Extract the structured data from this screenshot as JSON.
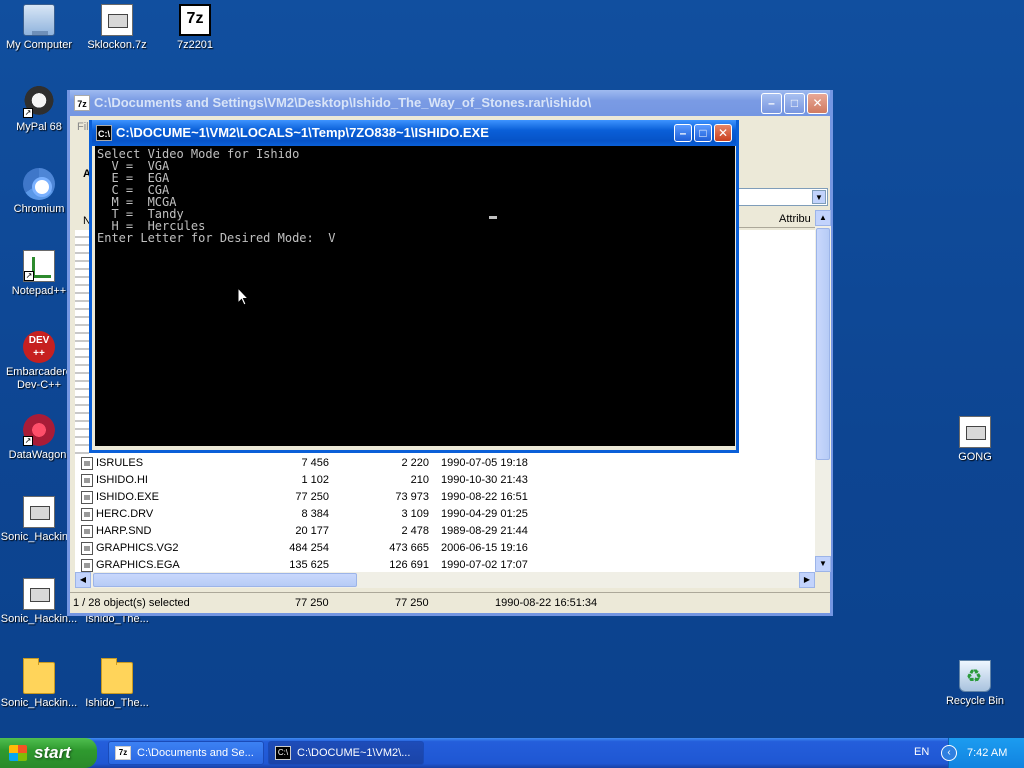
{
  "desktop_icons": {
    "my_computer": "My Computer",
    "sklockon": "Sklockon.7z",
    "zip7": "7z2201",
    "mypal": "MyPal 68",
    "chromium": "Chromium",
    "notepad": "Notepad++",
    "embarcadero_line1": "Embarcadero",
    "embarcadero_line2": "Dev-C++",
    "datawagon": "DataWagon.",
    "sonic1": "Sonic_Hackin...",
    "sonic2": "Sonic_Hackin...",
    "ishido_file": "Ishido_The...",
    "sonic3": "Sonic_Hackin...",
    "ishido_folder": "Ishido_The...",
    "gong": "GONG",
    "recycle_bin": "Recycle Bin",
    "dev_badge": "DEV\n++",
    "zip_badge": "7z"
  },
  "explorer": {
    "title": "C:\\Documents and Settings\\VM2\\Desktop\\Ishido_The_Way_of_Stones.rar\\ishido\\",
    "menu_hint": "Fil",
    "col_partial_a": "A",
    "col_partial_n": "N",
    "attrib_header": "Attribu",
    "rows": [
      {
        "name": "ISRULES",
        "size": "7 456",
        "packed": "2 220",
        "modified": "1990-07-05 19:18"
      },
      {
        "name": "ISHIDO.HI",
        "size": "1 102",
        "packed": "210",
        "modified": "1990-10-30 21:43"
      },
      {
        "name": "ISHIDO.EXE",
        "size": "77 250",
        "packed": "73 973",
        "modified": "1990-08-22 16:51"
      },
      {
        "name": "HERC.DRV",
        "size": "8 384",
        "packed": "3 109",
        "modified": "1990-04-29 01:25"
      },
      {
        "name": "HARP.SND",
        "size": "20 177",
        "packed": "2 478",
        "modified": "1989-08-29 21:44"
      },
      {
        "name": "GRAPHICS.VG2",
        "size": "484 254",
        "packed": "473 665",
        "modified": "2006-06-15 19:16"
      },
      {
        "name": "GRAPHICS.EGA",
        "size": "135 625",
        "packed": "126 691",
        "modified": "1990-07-02 17:07"
      }
    ],
    "status": {
      "selection": "1 / 28 object(s) selected",
      "size": "77 250",
      "packed": "77 250",
      "modified": "1990-08-22 16:51:34"
    }
  },
  "console": {
    "title": "C:\\DOCUME~1\\VM2\\LOCALS~1\\Temp\\7ZO838~1\\ISHIDO.EXE",
    "icon_text": "C:\\",
    "lines": [
      "Select Video Mode for Ishido",
      "  V =  VGA",
      "  E =  EGA",
      "  C =  CGA",
      "  M =  MCGA",
      "  T =  Tandy",
      "  H =  Hercules",
      "Enter Letter for Desired Mode:  V"
    ]
  },
  "taskbar": {
    "start_label": "start",
    "tasks": [
      {
        "label": "C:\\Documents and Se...",
        "icon": "7z"
      },
      {
        "label": "C:\\DOCUME~1\\VM2\\...",
        "icon": "C:\\"
      }
    ],
    "language": "EN",
    "clock": "7:42 AM"
  },
  "colors": {
    "desktop": "#0f4d9c",
    "titlebar_active": "#0a5fd8",
    "console_bg": "#000000",
    "console_text": "#c0c0c0"
  }
}
